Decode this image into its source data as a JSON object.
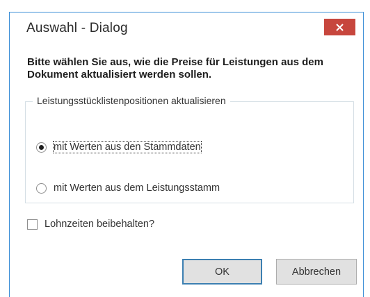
{
  "dialog": {
    "title": "Auswahl - Dialog",
    "close_icon": "close-x-icon",
    "accent_color": "#3c8fd7",
    "close_color": "#c7463d",
    "instruction": "Bitte wählen Sie aus, wie die Preise für Leistungen aus dem Dokument aktualisiert werden sollen.",
    "group": {
      "legend": "Leistungsstücklistenpositionen aktualisieren",
      "options": [
        {
          "label": "mit Werten aus den Stammdaten",
          "checked": true
        },
        {
          "label": "mit Werten aus dem Leistungsstamm",
          "checked": false
        }
      ]
    },
    "checkbox": {
      "label": "Lohnzeiten beibehalten?",
      "checked": false
    },
    "buttons": {
      "ok_label": "OK",
      "cancel_label": "Abbrechen"
    }
  }
}
